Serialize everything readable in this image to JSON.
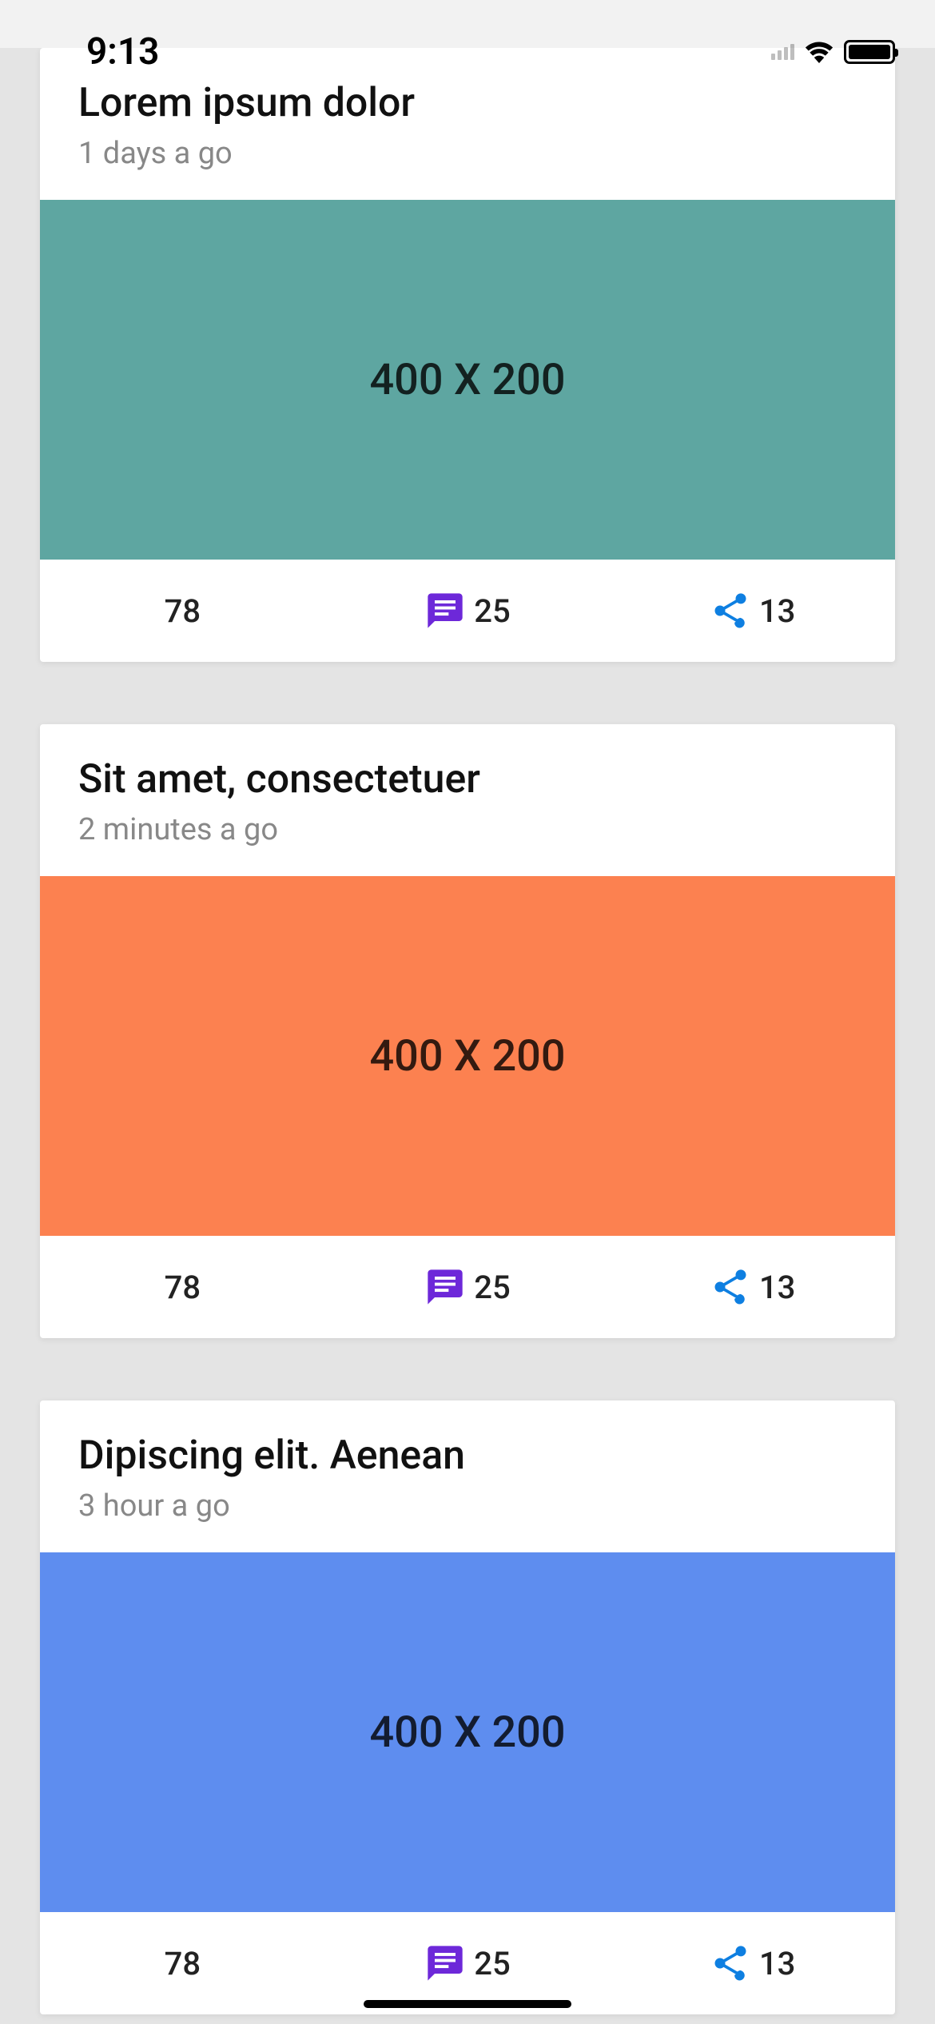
{
  "status_bar": {
    "time": "9:13"
  },
  "feed": [
    {
      "title": "Lorem ipsum dolor",
      "time": "1 days a go",
      "image_label": "400 X 200",
      "image_bg": "#5ea6a1",
      "likes": "78",
      "comments": "25",
      "shares": "13"
    },
    {
      "title": "Sit amet, consectetuer",
      "time": "2 minutes a go",
      "image_label": "400 X 200",
      "image_bg": "#fc8150",
      "likes": "78",
      "comments": "25",
      "shares": "13"
    },
    {
      "title": "Dipiscing elit. Aenean",
      "time": "3 hour a go",
      "image_label": "400 X 200",
      "image_bg": "#5e8def",
      "likes": "78",
      "comments": "25",
      "shares": "13"
    }
  ]
}
